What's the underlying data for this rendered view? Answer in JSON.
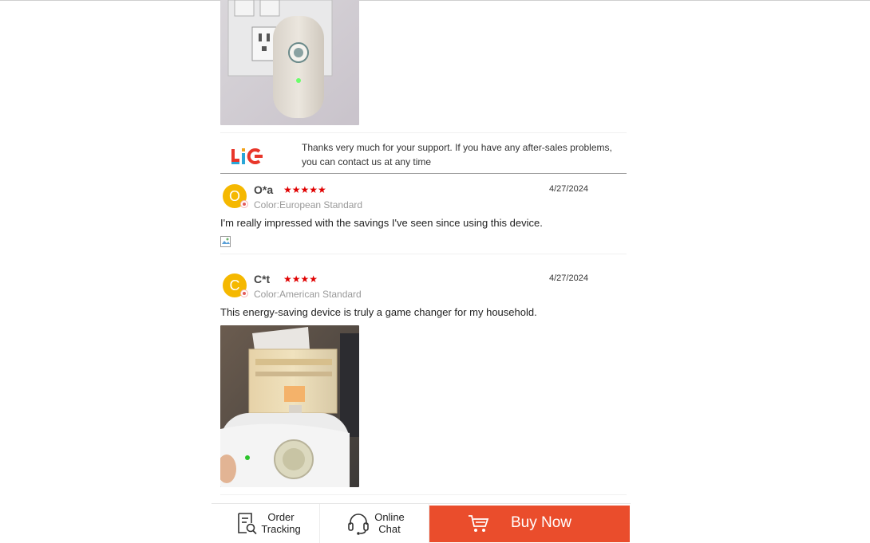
{
  "reply": {
    "text": "Thanks very much for your support. If you have any after-sales problems, you can contact us at any time",
    "logo_text": "LiC"
  },
  "reviews": [
    {
      "initial": "O",
      "name": "O*a",
      "stars": "★★★★★",
      "rating": 5,
      "date": "4/27/2024",
      "variant": "Color:European Standard",
      "text": "I'm really impressed with the savings I've seen since using this device."
    },
    {
      "initial": "C",
      "name": "C*t",
      "stars": "★★★★",
      "rating": 4,
      "date": "4/27/2024",
      "variant": "Color:American Standard",
      "text": "This energy-saving device is truly a game changer for my household."
    }
  ],
  "bottom_bar": {
    "order_tracking": "Order\nTracking",
    "online_chat": "Online\nChat",
    "buy_now": "Buy Now"
  },
  "colors": {
    "accent": "#ea4d2c",
    "star": "#e00000",
    "avatar": "#f5b800"
  }
}
